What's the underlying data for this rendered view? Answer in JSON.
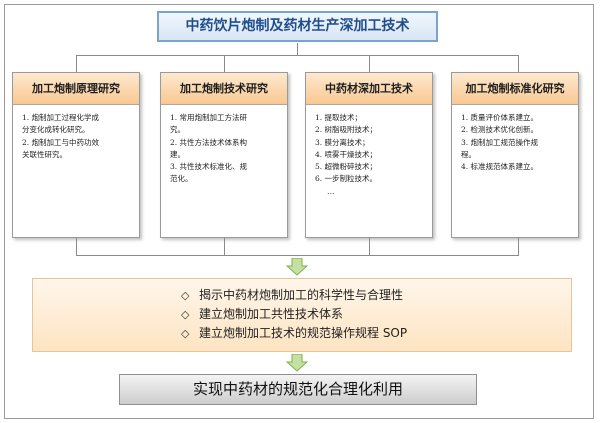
{
  "title": "中药饮片炮制及药材生产深加工技术",
  "columns": [
    {
      "header": "加工炮制原理研究",
      "items": [
        "1. 炮制加工过程化学成",
        "分变化成转化研究。",
        "2. 炮制加工与中药功效",
        "关联性研究。"
      ]
    },
    {
      "header": "加工炮制技术研究",
      "items": [
        "1. 常用炮制加工方法研",
        "究。",
        "2. 共性方法技术体系构",
        "建。",
        "3. 共性技术标准化、规",
        "范化。"
      ]
    },
    {
      "header": "中药材深加工技术",
      "items": [
        "1. 提取技术；",
        "2. 树脂吸附技术；",
        "3. 膜分离技术；",
        "4. 喷雾干燥技术；",
        "5. 超微粉碎技术；",
        "6. 一步制粒技术。",
        "…"
      ]
    },
    {
      "header": "加工炮制标准化研究",
      "items": [
        "1. 质量评价体系建立。",
        "2. 检测技术优化创新。",
        "3. 炮制加工规范操作规",
        "程。",
        "4. 标准规范体系建立。"
      ]
    }
  ],
  "goals": [
    "揭示中药材炮制加工的科学性与合理性",
    "建立炮制加工共性技术体系",
    "建立炮制加工技术的规范操作规程 SOP"
  ],
  "result": "实现中药材的规范化合理化利用"
}
